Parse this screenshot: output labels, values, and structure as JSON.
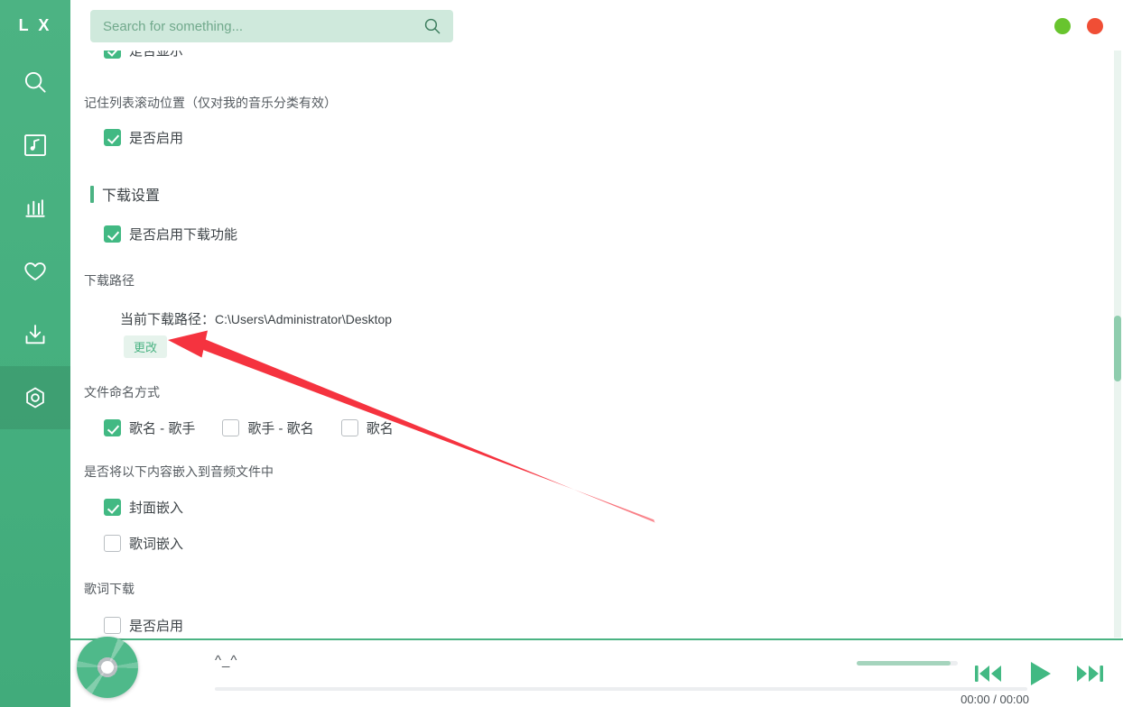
{
  "app": {
    "logo": "L X"
  },
  "search": {
    "placeholder": "Search for something...",
    "value": "",
    "icon": "search-icon"
  },
  "window_controls": {
    "minimize_color": "#68c42e",
    "close_color": "#f04e35"
  },
  "sidebar": {
    "items": [
      {
        "name": "search",
        "icon": "search-icon",
        "active": false
      },
      {
        "name": "music-library",
        "icon": "music-album-icon",
        "active": false
      },
      {
        "name": "ranking",
        "icon": "bar-chart-icon",
        "active": false
      },
      {
        "name": "favorites",
        "icon": "heart-icon",
        "active": false
      },
      {
        "name": "downloads",
        "icon": "download-icon",
        "active": false
      },
      {
        "name": "settings",
        "icon": "gear-hexagon-icon",
        "active": true
      }
    ]
  },
  "settings": {
    "clipped_top_row": {
      "label": "是否显示",
      "checked": true
    },
    "remember_scroll": {
      "label": "记住列表滚动位置（仅对我的音乐分类有效）",
      "option_label": "是否启用",
      "checked": true
    },
    "download_section": {
      "title": "下载设置",
      "enable_download": {
        "label": "是否启用下载功能",
        "checked": true
      },
      "download_path": {
        "label": "下载路径",
        "current_label": "当前下载路径：",
        "current_value": "C:\\Users\\Administrator\\Desktop",
        "change_button": "更改"
      },
      "file_naming": {
        "label": "文件命名方式",
        "options": [
          {
            "label": "歌名 - 歌手",
            "checked": true
          },
          {
            "label": "歌手 - 歌名",
            "checked": false
          },
          {
            "label": "歌名",
            "checked": false
          }
        ]
      },
      "embed": {
        "label": "是否将以下内容嵌入到音频文件中",
        "options": [
          {
            "label": "封面嵌入",
            "checked": true
          },
          {
            "label": "歌词嵌入",
            "checked": false
          }
        ]
      },
      "lyric_download": {
        "label": "歌词下载",
        "option_label": "是否启用",
        "checked": false
      }
    }
  },
  "player": {
    "song_title": "^_^",
    "time": "00:00 / 00:00",
    "progress_percent": 0,
    "volume_percent": 93,
    "controls": [
      {
        "name": "previous",
        "icon": "skip-previous-icon"
      },
      {
        "name": "play",
        "icon": "play-icon"
      },
      {
        "name": "next",
        "icon": "skip-next-icon"
      }
    ],
    "album_art": "vinyl-disc-icon"
  },
  "annotation": {
    "type": "arrow",
    "color": "#f5333f",
    "points_to": "change-download-path-button"
  },
  "theme": {
    "accent": "#4bb383",
    "search_bg": "#cfe9dc",
    "checkbox_checked": "#42b983"
  }
}
